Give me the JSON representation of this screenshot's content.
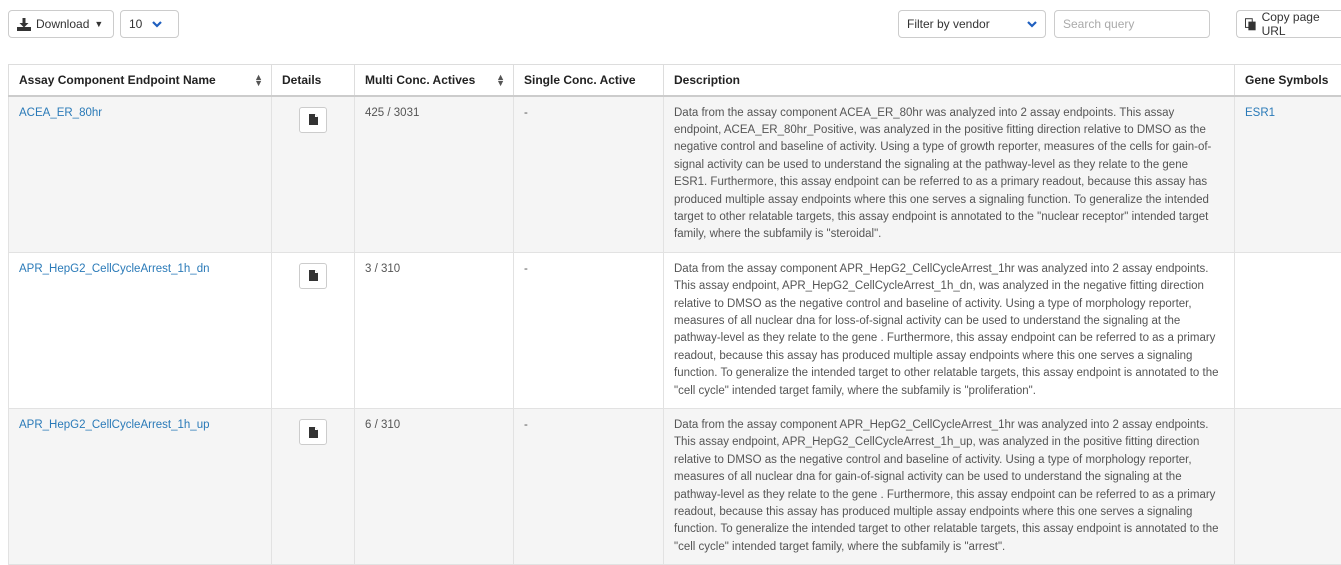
{
  "toolbar": {
    "download_label": "Download",
    "page_size_value": "10",
    "vendor_filter_label": "Filter by vendor",
    "search_placeholder": "Search query",
    "copy_url_label": "Copy page URL"
  },
  "table": {
    "headers": {
      "name": "Assay Component Endpoint Name",
      "details": "Details",
      "multi": "Multi Conc. Actives",
      "single": "Single Conc. Active",
      "description": "Description",
      "genes": "Gene Symbols"
    },
    "rows": [
      {
        "name": "ACEA_ER_80hr",
        "multi": "425 / 3031",
        "single": "-",
        "description": "Data from the assay component ACEA_ER_80hr was analyzed into 2 assay endpoints. This assay endpoint, ACEA_ER_80hr_Positive, was analyzed in the positive fitting direction relative to DMSO as the negative control and baseline of activity. Using a type of growth reporter, measures of the cells for gain-of-signal activity can be used to understand the signaling at the pathway-level as they relate to the gene ESR1. Furthermore, this assay endpoint can be referred to as a primary readout, because this assay has produced multiple assay endpoints where this one serves a signaling function. To generalize the intended target to other relatable targets, this assay endpoint is annotated to the \"nuclear receptor\" intended target family, where the subfamily is \"steroidal\".",
        "genes": "ESR1"
      },
      {
        "name": "APR_HepG2_CellCycleArrest_1h_dn",
        "multi": "3 / 310",
        "single": "-",
        "description": "Data from the assay component APR_HepG2_CellCycleArrest_1hr was analyzed into 2 assay endpoints. This assay endpoint, APR_HepG2_CellCycleArrest_1h_dn, was analyzed in the negative fitting direction relative to DMSO as the negative control and baseline of activity. Using a type of morphology reporter, measures of all nuclear dna for loss-of-signal activity can be used to understand the signaling at the pathway-level as they relate to the gene . Furthermore, this assay endpoint can be referred to as a primary readout, because this assay has produced multiple assay endpoints where this one serves a signaling function. To generalize the intended target to other relatable targets, this assay endpoint is annotated to the \"cell cycle\" intended target family, where the subfamily is \"proliferation\".",
        "genes": ""
      },
      {
        "name": "APR_HepG2_CellCycleArrest_1h_up",
        "multi": "6 / 310",
        "single": "-",
        "description": "Data from the assay component APR_HepG2_CellCycleArrest_1hr was analyzed into 2 assay endpoints. This assay endpoint, APR_HepG2_CellCycleArrest_1h_up, was analyzed in the positive fitting direction relative to DMSO as the negative control and baseline of activity. Using a type of morphology reporter, measures of all nuclear dna for gain-of-signal activity can be used to understand the signaling at the pathway-level as they relate to the gene . Furthermore, this assay endpoint can be referred to as a primary readout, because this assay has produced multiple assay endpoints where this one serves a signaling function. To generalize the intended target to other relatable targets, this assay endpoint is annotated to the \"cell cycle\" intended target family, where the subfamily is \"arrest\".",
        "genes": ""
      }
    ]
  }
}
